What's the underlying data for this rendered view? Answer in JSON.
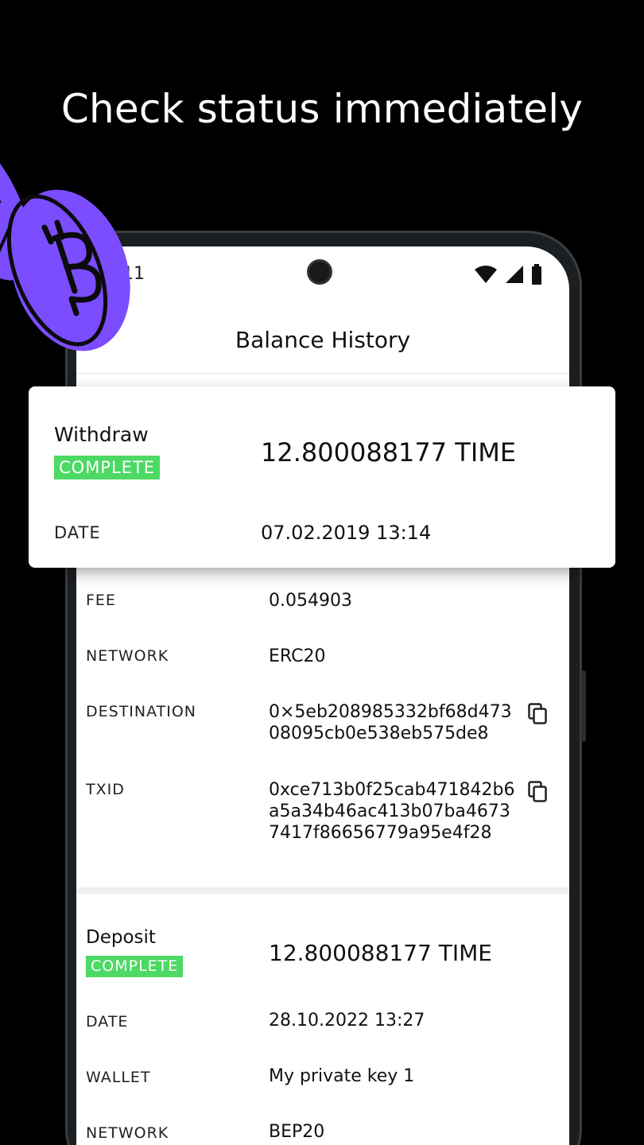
{
  "headline": "Check status immediately",
  "status_bar": {
    "time": "11"
  },
  "app": {
    "title": "Balance History"
  },
  "highlighted_card": {
    "type": "Withdraw",
    "status": "COMPLETE",
    "amount": "12.800088177 TIME",
    "date_label": "DATE",
    "date_value": "07.02.2019 13:14"
  },
  "withdraw_details": [
    {
      "label": "FEE",
      "value": "0.054903"
    },
    {
      "label": "NETWORK",
      "value": "ERC20"
    },
    {
      "label": "DESTINATION",
      "value": "0×5eb208985332bf68d47308095cb0e538eb575de8"
    },
    {
      "label": "TXID",
      "value": "0xce713b0f25cab471842b6a5a34b46ac413b07ba46737417f86656779a95e4f28"
    }
  ],
  "deposit": {
    "type": "Deposit",
    "status": "COMPLETE",
    "amount": "12.800088177 TIME",
    "details": [
      {
        "label": "DATE",
        "value": "28.10.2022 13:27"
      },
      {
        "label": "WALLET",
        "value": "My private key 1"
      },
      {
        "label": "NETWORK",
        "value": "BEP20"
      }
    ]
  },
  "colors": {
    "badge_green": "#4cd964",
    "coin_purple": "#7b4dff",
    "background": "#000000"
  },
  "icons": {
    "copy": "copy-icon",
    "wifi": "wifi-icon",
    "signal": "signal-icon",
    "battery": "battery-icon",
    "coin": "bitcoin-coin-icon"
  }
}
